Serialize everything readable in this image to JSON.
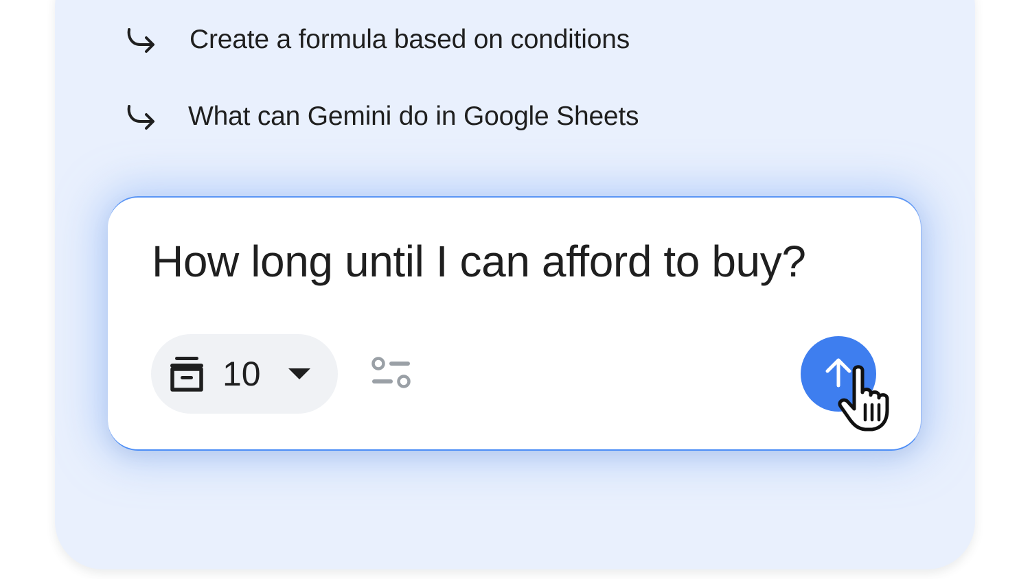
{
  "suggestions": [
    {
      "label": "Create a formula based on conditions",
      "icon": "subdirectory-arrow-right-icon"
    },
    {
      "label": "What can Gemini do in Google Sheets",
      "icon": "subdirectory-arrow-right-icon"
    }
  ],
  "prompt": {
    "text": "How long until I can afford to buy?"
  },
  "source_chip": {
    "icon": "archive-stack-icon",
    "count": "10",
    "dropdown_icon": "caret-down-icon"
  },
  "tune_icon": "tune-settings-icon",
  "send_button": {
    "icon": "arrow-up-icon"
  },
  "cursor_icon": "hand-pointer-icon",
  "colors": {
    "panel_background": "#e9f0fd",
    "accent_blue": "#3e7eef",
    "chip_background": "#f0f2f5",
    "text_primary": "#1f1f1f",
    "icon_gray": "#9aa0a6"
  }
}
